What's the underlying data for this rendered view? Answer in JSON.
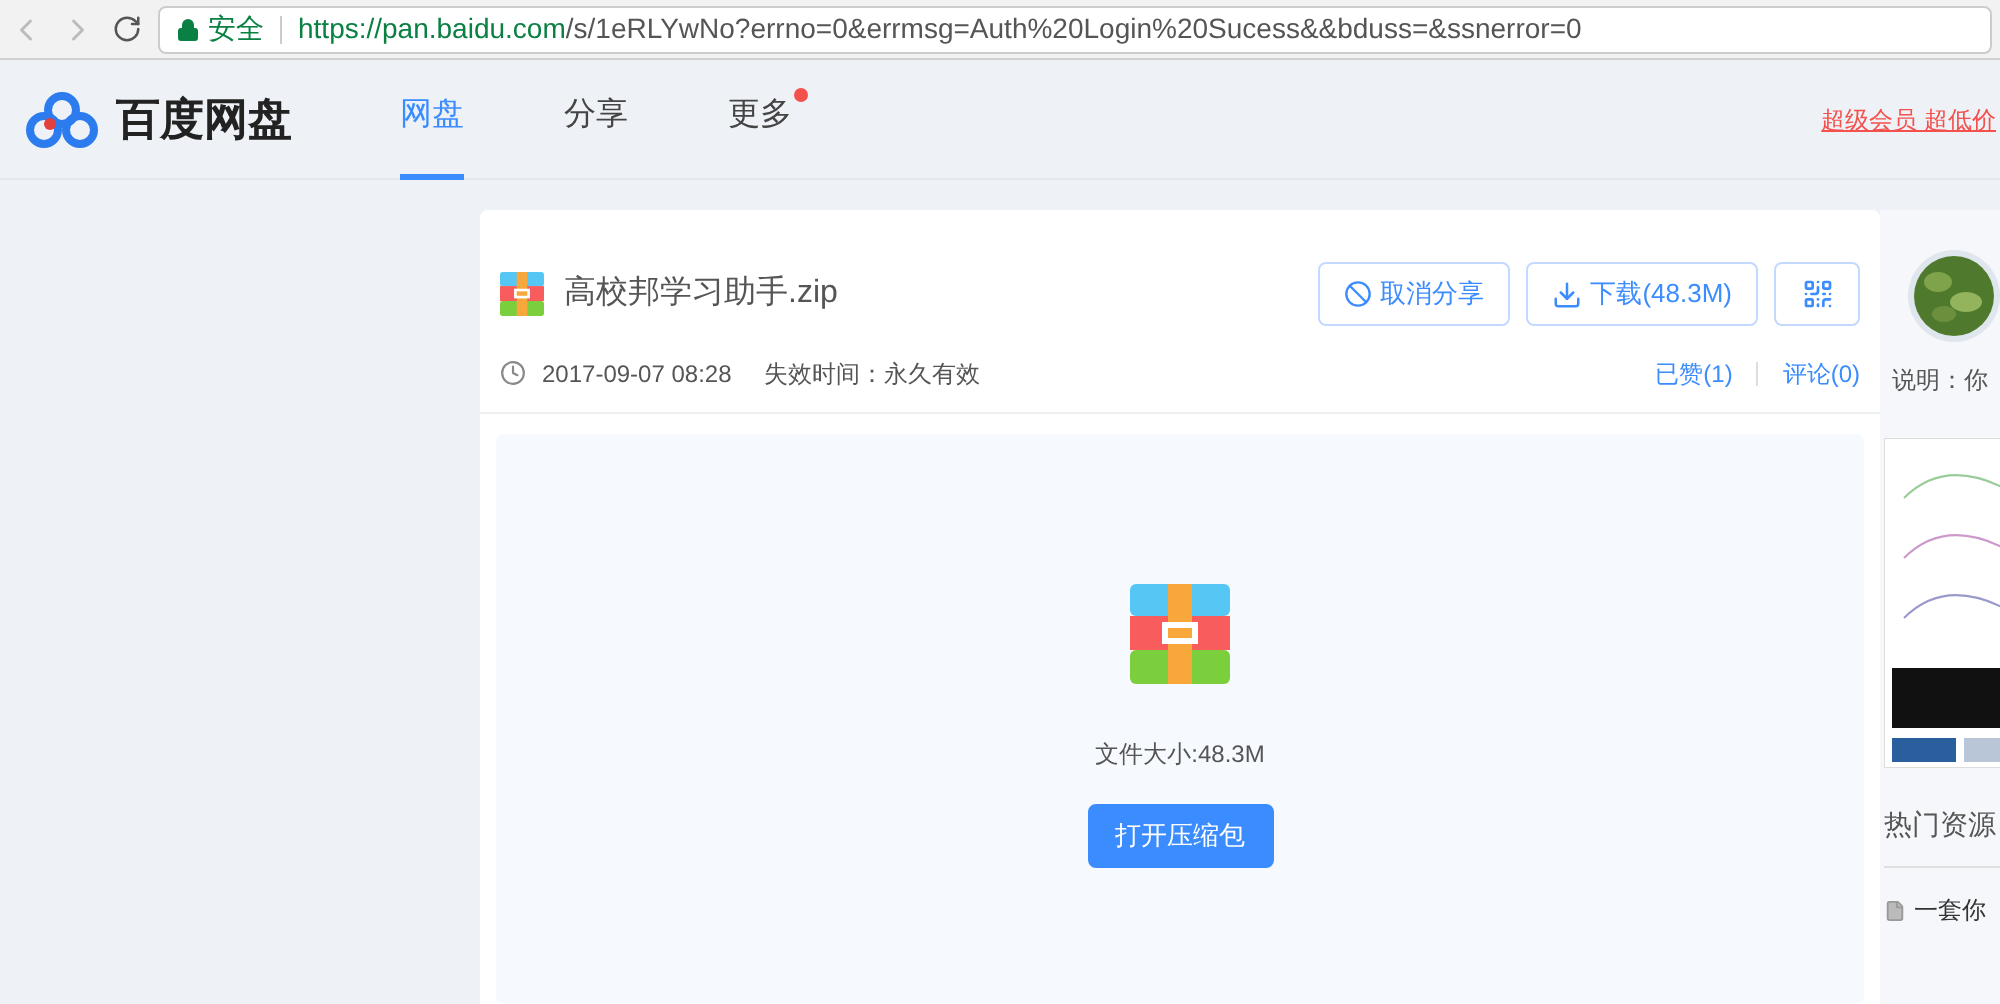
{
  "browser": {
    "secure_label": "安全",
    "url_host": "https://pan.baidu.com",
    "url_path": "/s/1eRLYwNo?errno=0&errmsg=Auth%20Login%20Sucess&&bduss=&ssnerror=0"
  },
  "header": {
    "logo": "百度网盘",
    "nav": [
      {
        "label": "网盘",
        "selected": true,
        "dot": false
      },
      {
        "label": "分享",
        "selected": false,
        "dot": false
      },
      {
        "label": "更多",
        "selected": false,
        "dot": true
      }
    ],
    "promo": "超级会员 超低价"
  },
  "file": {
    "name": "高校邦学习助手.zip",
    "date": "2017-09-07 08:28",
    "expiry": "失效时间：永久有效",
    "cancel_share": "取消分享",
    "download": "下载(48.3M)",
    "likes": "已赞(1)",
    "comments": "评论(0)",
    "size": "文件大小:48.3M",
    "open_button": "打开压缩包"
  },
  "side": {
    "description": "说明：你",
    "hot_title": "热门资源",
    "hot_item": "一套你"
  }
}
